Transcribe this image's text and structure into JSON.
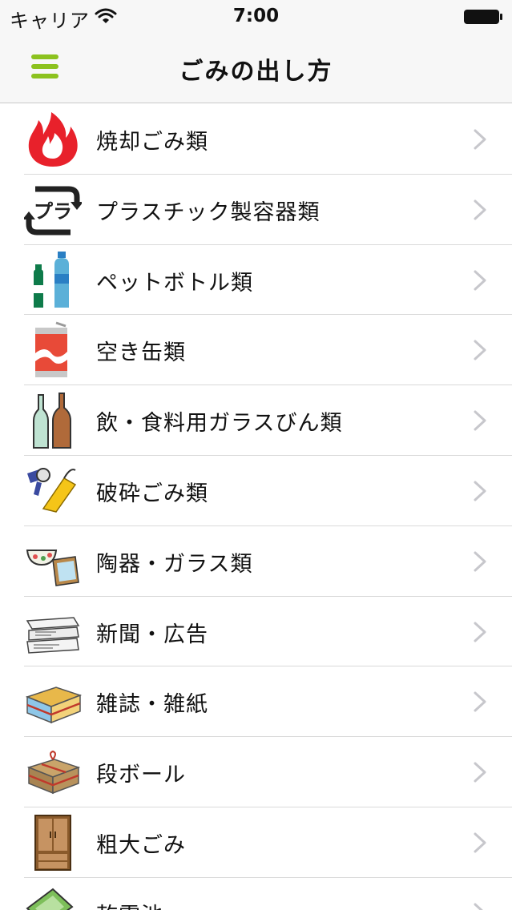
{
  "status_bar": {
    "carrier": "キャリア",
    "time": "7:00"
  },
  "nav": {
    "title": "ごみの出し方"
  },
  "categories": [
    {
      "label": "焼却ごみ類",
      "icon": "flame-icon"
    },
    {
      "label": "プラスチック製容器類",
      "icon": "plastic-recycle-icon"
    },
    {
      "label": "ペットボトル類",
      "icon": "pet-bottle-icon"
    },
    {
      "label": "空き缶類",
      "icon": "can-icon"
    },
    {
      "label": "飲・食料用ガラスびん類",
      "icon": "glass-bottle-icon"
    },
    {
      "label": "破砕ごみ類",
      "icon": "dryer-umbrella-icon"
    },
    {
      "label": "陶器・ガラス類",
      "icon": "bowl-mirror-icon"
    },
    {
      "label": "新聞・広告",
      "icon": "newspaper-icon"
    },
    {
      "label": "雑誌・雑紙",
      "icon": "magazine-bundle-icon"
    },
    {
      "label": "段ボール",
      "icon": "cardboard-icon"
    },
    {
      "label": "粗大ごみ",
      "icon": "cabinet-icon"
    },
    {
      "label": "乾電池",
      "icon": "battery-icon"
    }
  ],
  "colors": {
    "accent": "#8cc21f",
    "flame": "#e8212b",
    "chevron": "#c7c7cc",
    "separator": "#d9d9d9"
  }
}
